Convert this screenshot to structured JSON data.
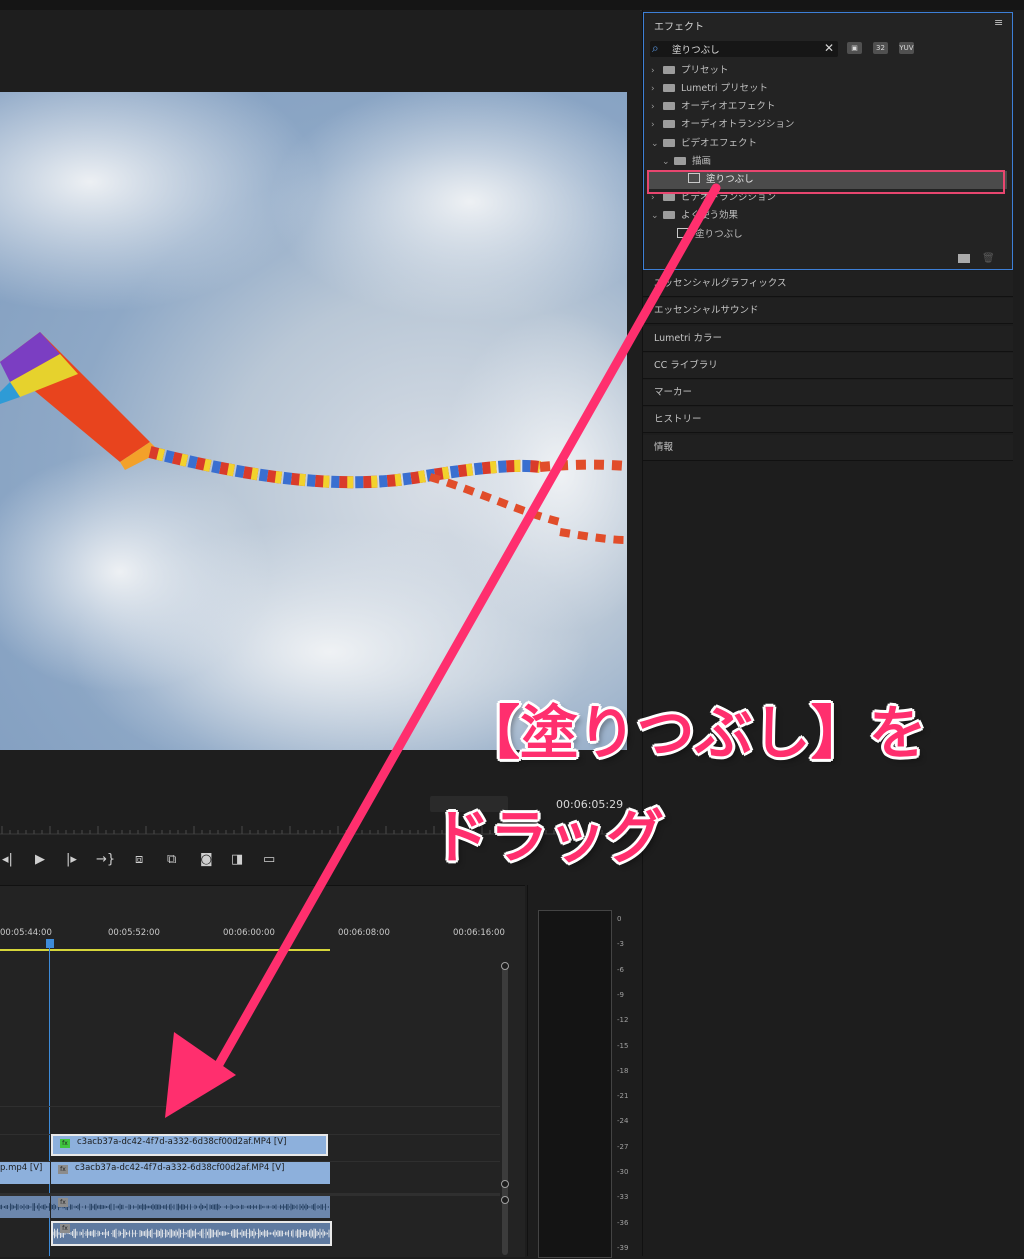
{
  "effects_panel": {
    "title": "エフェクト",
    "menu_icon": "hamburger-icon",
    "search": {
      "value": "塗りつぶし",
      "icon": "search-icon",
      "clear": "✕"
    },
    "filter_icons": [
      "32",
      "YUV"
    ],
    "tree": [
      {
        "label": "プリセット",
        "expanded": false,
        "type": "preset-folder"
      },
      {
        "label": "Lumetri プリセット",
        "expanded": false,
        "type": "preset-folder"
      },
      {
        "label": "オーディオエフェクト",
        "expanded": false,
        "type": "folder"
      },
      {
        "label": "オーディオトランジション",
        "expanded": false,
        "type": "folder"
      },
      {
        "label": "ビデオエフェクト",
        "expanded": true,
        "type": "folder"
      },
      {
        "label": "描画",
        "expanded": true,
        "type": "folder"
      },
      {
        "label": "塗りつぶし",
        "type": "effect",
        "selected": true
      },
      {
        "label": "ビデオトランジション",
        "expanded": false,
        "type": "folder"
      },
      {
        "label": "よく使う効果",
        "expanded": true,
        "type": "folder"
      },
      {
        "label": "塗りつぶし",
        "type": "effect"
      }
    ]
  },
  "panels": [
    "エッセンシャルグラフィックス",
    "エッセンシャルサウンド",
    "Lumetri カラー",
    "CC ライブラリ",
    "マーカー",
    "ヒストリー",
    "情報"
  ],
  "monitor": {
    "timecode": "00:06:05:29"
  },
  "transport_icons": [
    "step-back-icon",
    "play-icon",
    "step-forward-icon",
    "go-to-out-icon",
    "insert-icon",
    "overwrite-icon",
    "camera-icon",
    "compare-icon",
    "safe-margins-icon"
  ],
  "timeline": {
    "times": [
      "00:05:44:00",
      "00:05:52:00",
      "00:06:00:00",
      "00:06:08:00",
      "00:06:16:00"
    ],
    "clip_top": "c3acb37a-dc42-4f7d-a332-6d38cf00d2af.MP4 [V]",
    "clip_main": "c3acb37a-dc42-4f7d-a332-6d38cf00d2af.MP4 [V]",
    "clip_left": "p.mp4 [V]",
    "fx_badge": "fx"
  },
  "meter_scale": [
    "0",
    "-3",
    "-6",
    "-9",
    "-12",
    "-15",
    "-18",
    "-21",
    "-24",
    "-27",
    "-30",
    "-33",
    "-36",
    "-39"
  ],
  "annotation": {
    "line1": "【塗りつぶし】を",
    "line2": "ドラッグ",
    "color": "#ff2f6e"
  }
}
